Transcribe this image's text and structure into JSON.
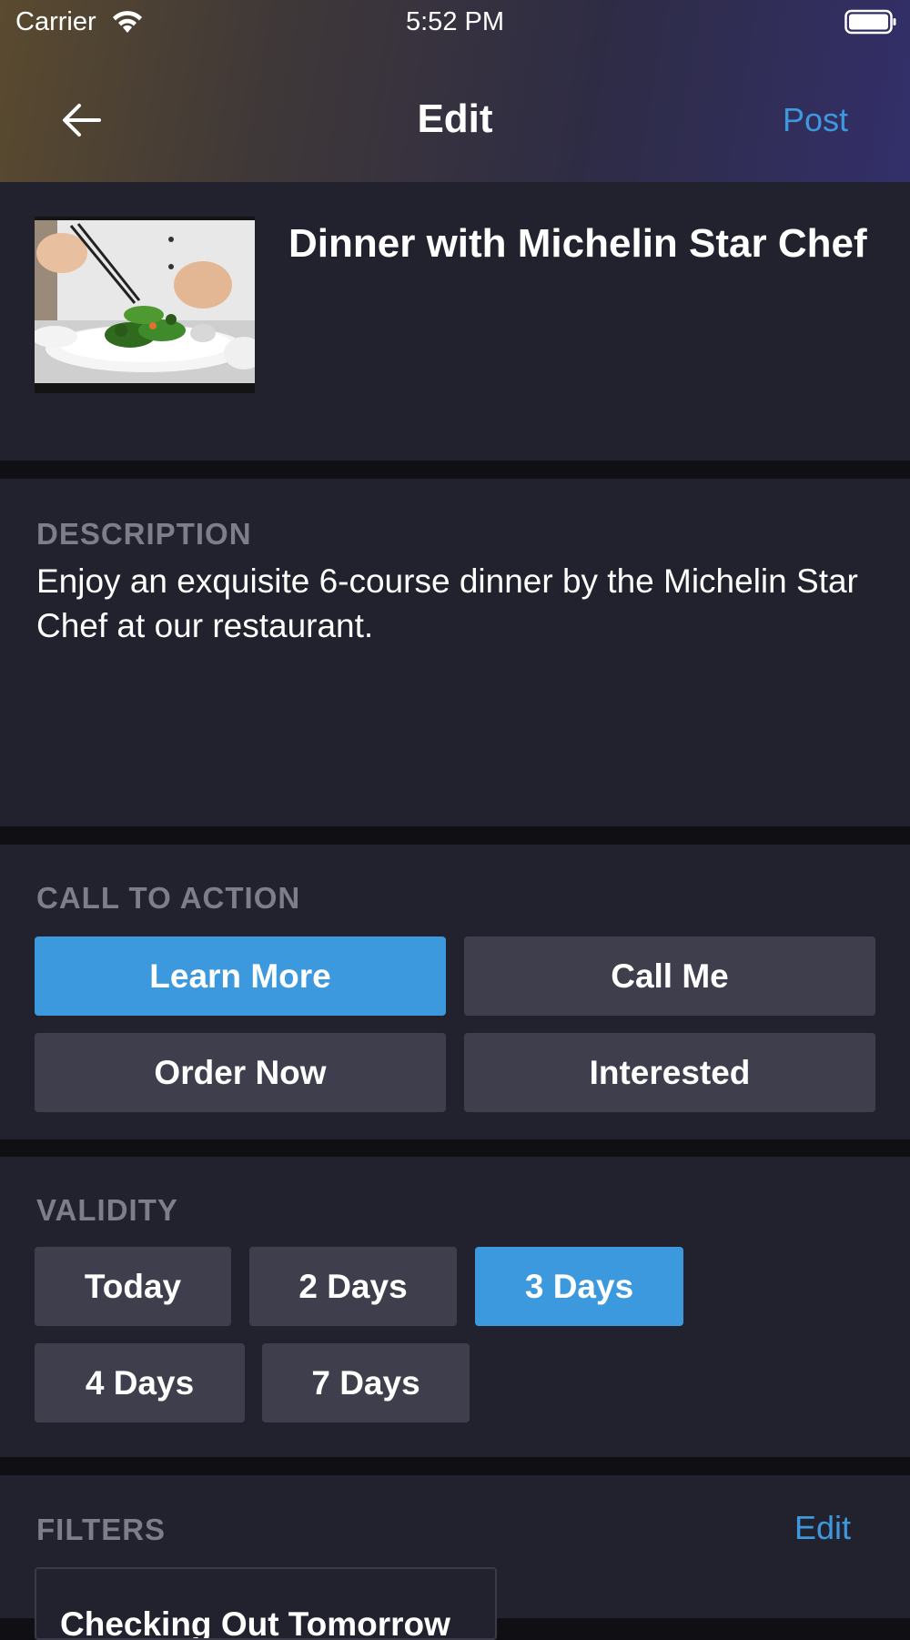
{
  "status_bar": {
    "carrier": "Carrier",
    "time": "5:52 PM"
  },
  "nav": {
    "title": "Edit",
    "post_label": "Post",
    "back_icon": "arrow-left-icon"
  },
  "event": {
    "title": "Dinner with Michelin Star Chef",
    "image_alt": "chef plating a dish"
  },
  "description": {
    "label": "DESCRIPTION",
    "text": "Enjoy an exquisite 6-course dinner by the Michelin Star Chef at our restaurant."
  },
  "call_to_action": {
    "label": "CALL TO ACTION",
    "options": [
      "Learn More",
      "Call Me",
      "Order Now",
      "Interested"
    ],
    "selected": "Learn More"
  },
  "validity": {
    "label": "VALIDITY",
    "options": [
      "Today",
      "2 Days",
      "3 Days",
      "4 Days",
      "7 Days"
    ],
    "selected": "3 Days"
  },
  "filters": {
    "label": "FILTERS",
    "edit_label": "Edit",
    "chips": [
      "Checking Out Tomorrow"
    ]
  },
  "colors": {
    "accent": "#3d99dd",
    "card_bg": "#22222e",
    "button_bg": "#3e3e4d",
    "label_gray": "#7e7e8a"
  }
}
